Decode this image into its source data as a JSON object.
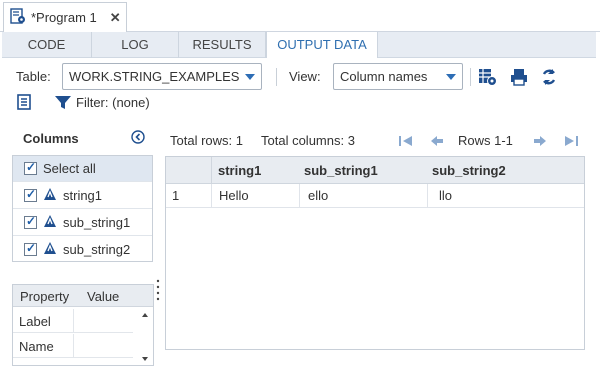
{
  "program_tab": {
    "title": "*Program 1",
    "close": "✕"
  },
  "subtabs": [
    {
      "label": "CODE"
    },
    {
      "label": "LOG"
    },
    {
      "label": "RESULTS"
    },
    {
      "label": "OUTPUT DATA",
      "active": true
    }
  ],
  "toolbar": {
    "table_label": "Table:",
    "table_value": "WORK.STRING_EXAMPLES",
    "view_label": "View:",
    "view_value": "Column names"
  },
  "filter": {
    "label": "Filter: (none)"
  },
  "columns_panel": {
    "title": "Columns",
    "select_all": "Select all",
    "items": [
      {
        "label": "string1"
      },
      {
        "label": "sub_string1"
      },
      {
        "label": "sub_string2"
      }
    ]
  },
  "properties_panel": {
    "headers": {
      "property": "Property",
      "value": "Value"
    },
    "rows": [
      {
        "property": "Label",
        "value": ""
      },
      {
        "property": "Name",
        "value": ""
      }
    ]
  },
  "data_view": {
    "total_rows": "Total rows: 1",
    "total_columns": "Total columns: 3",
    "rows_range": "Rows 1-1",
    "headers": [
      "string1",
      "sub_string1",
      "sub_string2"
    ],
    "rows": [
      {
        "index": "1",
        "cells": [
          "Hello",
          "ello",
          "llo"
        ]
      }
    ]
  },
  "colors": {
    "accent": "#2f6fb0",
    "icon_blue": "#1f4f8f"
  }
}
